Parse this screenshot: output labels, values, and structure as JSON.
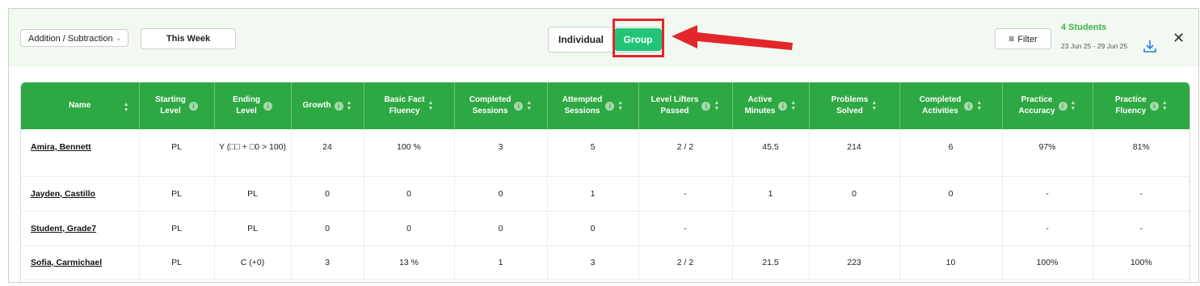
{
  "toolbar": {
    "operation": "Addition / Subtraction",
    "period": "This Week",
    "view_individual": "Individual",
    "view_group": "Group",
    "filter": "Filter",
    "students_count": "4 Students",
    "date_range": "23 Jun 25 - 29 Jun 25"
  },
  "colors": {
    "accent_green": "#2ea843",
    "toggle_active": "#22c47a",
    "annotation_red": "#e3262a",
    "students_text": "#3cb54a"
  },
  "icons": {
    "chevron": "chevron-down-icon",
    "filter": "filter-icon",
    "download": "download-icon",
    "close": "close-icon",
    "info": "info-icon",
    "sort": "sort-icon"
  },
  "table": {
    "headers": [
      {
        "line1": "Name",
        "line2": ""
      },
      {
        "line1": "Starting",
        "line2": "Level"
      },
      {
        "line1": "Ending",
        "line2": "Level"
      },
      {
        "line1": "Growth",
        "line2": ""
      },
      {
        "line1": "Basic Fact",
        "line2": "Fluency"
      },
      {
        "line1": "Completed",
        "line2": "Sessions"
      },
      {
        "line1": "Attempted",
        "line2": "Sessions"
      },
      {
        "line1": "Level Lifters",
        "line2": "Passed"
      },
      {
        "line1": "Active",
        "line2": "Minutes"
      },
      {
        "line1": "Problems",
        "line2": "Solved"
      },
      {
        "line1": "Completed",
        "line2": "Activities"
      },
      {
        "line1": "Practice",
        "line2": "Accuracy"
      },
      {
        "line1": "Practice",
        "line2": "Fluency"
      }
    ],
    "rows": [
      [
        "Amira, Bennett",
        "PL",
        "Y (□□ + □0 > 100)",
        "24",
        "100 %",
        "3",
        "5",
        "2 / 2",
        "45.5",
        "214",
        "6",
        "97%",
        "81%"
      ],
      [
        "Jayden, Castillo",
        "PL",
        "PL",
        "0",
        "0",
        "0",
        "1",
        "-",
        "1",
        "0",
        "0",
        "-",
        "-"
      ],
      [
        "Student, Grade7",
        "PL",
        "PL",
        "0",
        "0",
        "0",
        "0",
        "-",
        "",
        "",
        "",
        "-",
        "-"
      ],
      [
        "Sofia, Carmichael",
        "PL",
        "C (+0)",
        "3",
        "13 %",
        "1",
        "3",
        "2 / 2",
        "21.5",
        "223",
        "10",
        "100%",
        "100%"
      ]
    ]
  }
}
